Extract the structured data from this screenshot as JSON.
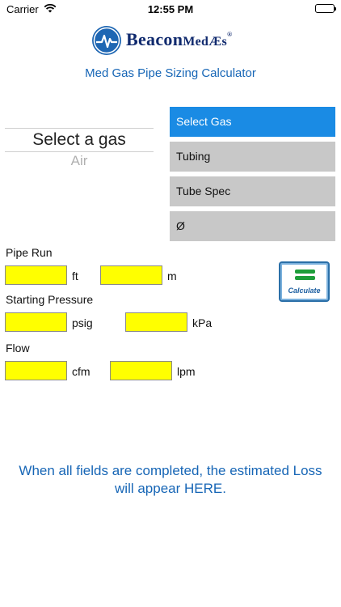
{
  "status_bar": {
    "carrier": "Carrier",
    "time": "12:55 PM"
  },
  "header": {
    "brand_main": "Beacon",
    "brand_small": "MedÆs",
    "registered": "®",
    "subtitle": "Med Gas Pipe Sizing Calculator"
  },
  "gas_picker": {
    "selected": "Select a gas",
    "next_option": "Air"
  },
  "options": [
    {
      "label": "Select Gas",
      "active": true
    },
    {
      "label": "Tubing",
      "active": false
    },
    {
      "label": "Tube Spec",
      "active": false
    },
    {
      "label": "Ø",
      "active": false
    }
  ],
  "pipe_run": {
    "label": "Pipe Run",
    "unit1": "ft",
    "unit2": "m",
    "value1": "",
    "value2": ""
  },
  "pressure": {
    "label": "Starting Pressure",
    "unit1": "psig",
    "unit2": "kPa",
    "value1": "",
    "value2": ""
  },
  "flow": {
    "label": "Flow",
    "unit1": "cfm",
    "unit2": "lpm",
    "value1": "",
    "value2": ""
  },
  "calculate": {
    "label": "Calculate"
  },
  "result_message": "When all fields are completed, the estimated Loss will appear HERE.",
  "colors": {
    "accent": "#1a8be4",
    "field": "#ffff00",
    "text_blue": "#1766b6",
    "button_gray": "#c8c8c8"
  }
}
